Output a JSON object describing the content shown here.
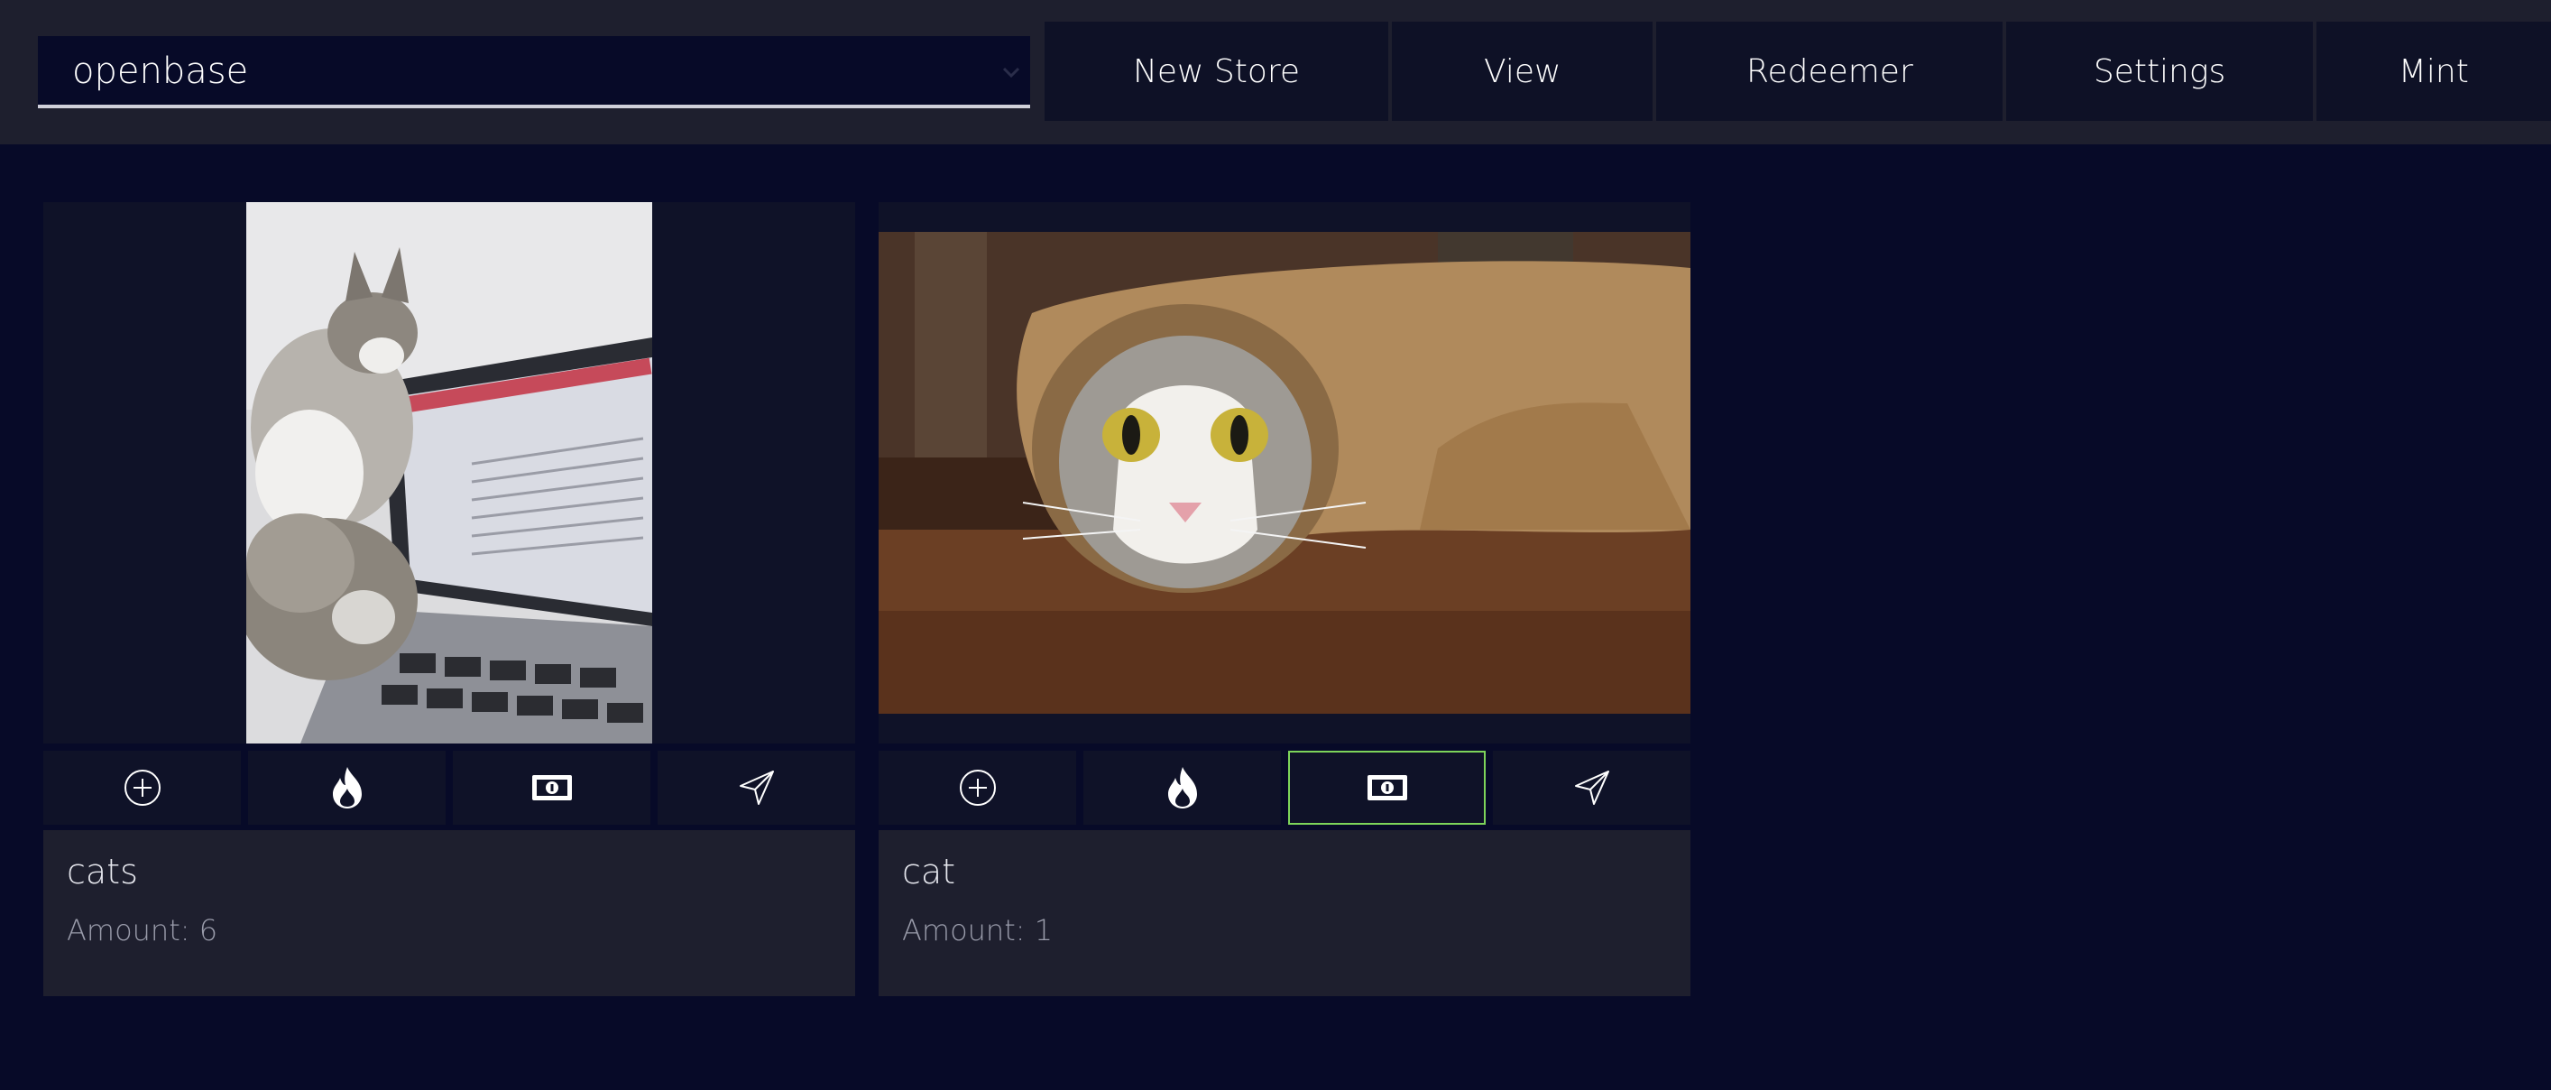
{
  "header": {
    "store_select": {
      "value": "openbase"
    },
    "nav": [
      {
        "label": "New Store"
      },
      {
        "label": "View"
      },
      {
        "label": "Redeemer"
      },
      {
        "label": "Settings"
      },
      {
        "label": "Mint"
      }
    ]
  },
  "cards": [
    {
      "name": "cats",
      "amount": "Amount: 6",
      "image_subject": "two kittens beside a laptop"
    },
    {
      "name": "cat",
      "amount": "Amount: 1",
      "image_subject": "cat peeking out of rolled brown paper"
    }
  ],
  "actions": [
    {
      "icon": "plus-circle-icon"
    },
    {
      "icon": "fire-icon"
    },
    {
      "icon": "banknote-icon"
    },
    {
      "icon": "send-icon"
    }
  ],
  "colors": {
    "background": "#070a28",
    "panel": "#1e1f2e",
    "button": "#0e1126",
    "active_border": "#7dd45a"
  }
}
